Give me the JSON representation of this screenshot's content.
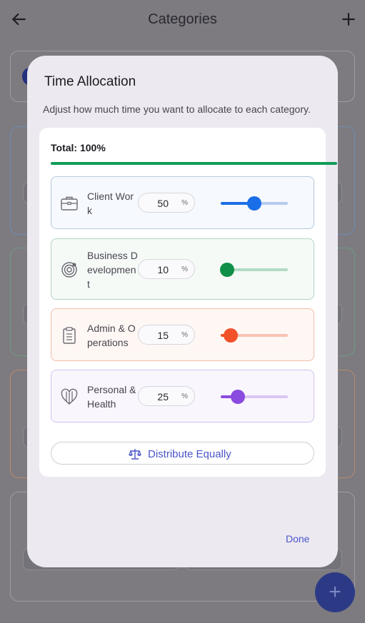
{
  "app_bar": {
    "title": "Categories"
  },
  "dialog": {
    "title": "Time Allocation",
    "subtitle": "Adjust how much time you want to allocate to each category.",
    "total_label": "Total: 100%",
    "total_value": 100,
    "rows": [
      {
        "label": "Client Work",
        "value": "50",
        "percent_symbol": "%",
        "icon": "briefcase-icon",
        "color": "#1a6ee8",
        "track_color": "#b6cbf0",
        "tint": "#f6f9fd",
        "border": "#b7c9de"
      },
      {
        "label": "Business Development",
        "value": "10",
        "percent_symbol": "%",
        "icon": "target-icon",
        "color": "#0f8f48",
        "track_color": "#b2dbc4",
        "tint": "#f5faf7",
        "border": "#b3d5c1"
      },
      {
        "label": "Admin & Operations",
        "value": "15",
        "percent_symbol": "%",
        "icon": "clipboard-icon",
        "color": "#f2522a",
        "track_color": "#f7c3b3",
        "tint": "#fef7f4",
        "border": "#f3bca9"
      },
      {
        "label": "Personal & Health",
        "value": "25",
        "percent_symbol": "%",
        "icon": "heart-icon",
        "color": "#8a4be0",
        "track_color": "#dac7f4",
        "tint": "#faf6fe",
        "border": "#d3c2ec"
      }
    ],
    "distribute_label": "Distribute Equally",
    "done_label": "Done"
  },
  "colors": {
    "accent": "#4a55c9",
    "total_bar": "#0f9d58",
    "fab": "#2c3a86"
  }
}
